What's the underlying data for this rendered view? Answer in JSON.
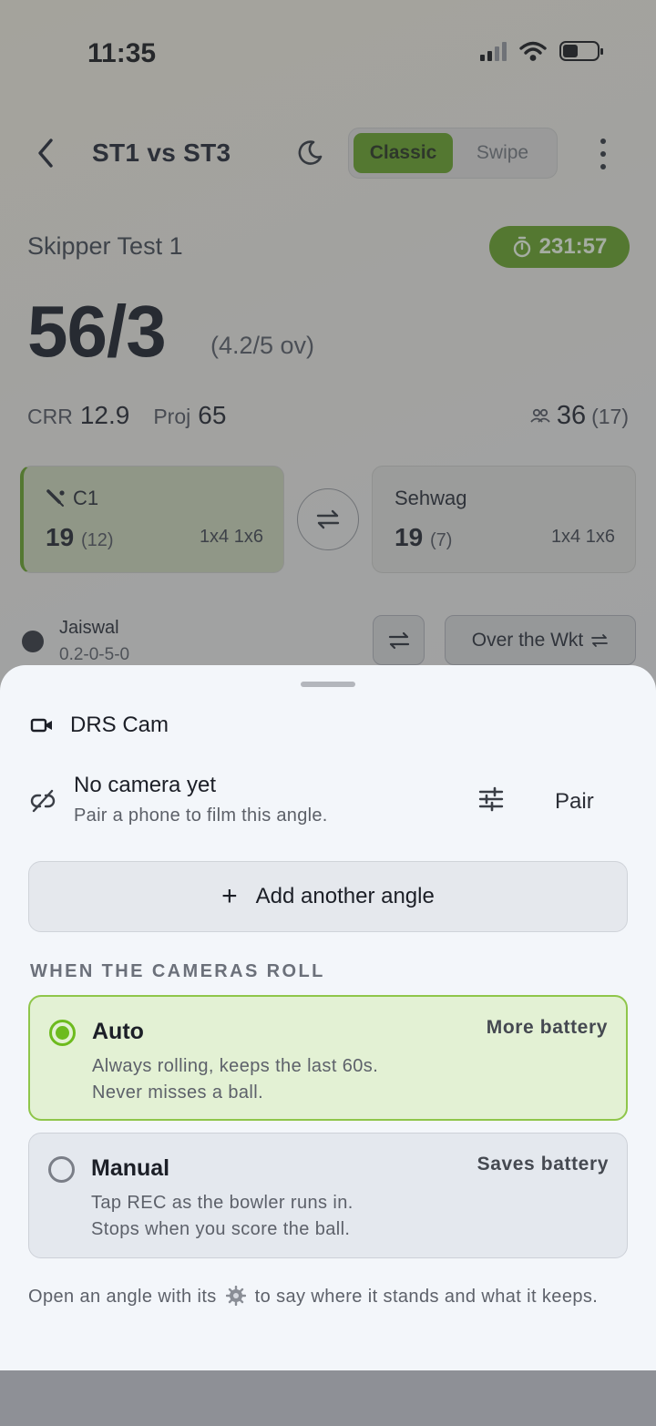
{
  "status_bar": {
    "time": "11:35"
  },
  "header": {
    "title": "ST1 vs ST3",
    "mode_options": [
      "Classic",
      "Swipe"
    ],
    "mode_selected": "Classic"
  },
  "innings": {
    "team": "Skipper Test 1",
    "timer": "231:57",
    "score": "56/3",
    "overs": "(4.2/5 ov)",
    "crr_label": "CRR",
    "crr": "12.9",
    "proj_label": "Proj",
    "proj": "65",
    "partnership_runs": "36",
    "partnership_balls": "(17)"
  },
  "batters": [
    {
      "name": "C1",
      "runs": "19",
      "balls": "(12)",
      "boundaries": "1x4 1x6",
      "on_strike": true
    },
    {
      "name": "Sehwag",
      "runs": "19",
      "balls": "(7)",
      "boundaries": "1x4 1x6",
      "on_strike": false
    }
  ],
  "bowler": {
    "name": "Jaiswal",
    "figures": "0.2-0-5-0",
    "side_label": "Over the Wkt"
  },
  "sheet": {
    "title": "DRS Cam",
    "camera": {
      "title": "No camera yet",
      "subtitle": "Pair a phone to film this angle.",
      "pair_label": "Pair"
    },
    "add_angle_label": "Add another angle",
    "section_label": "WHEN THE CAMERAS ROLL",
    "options": [
      {
        "title": "Auto",
        "tag": "More battery",
        "line1": "Always rolling, keeps the last 60s.",
        "line2": "Never misses a ball.",
        "selected": true
      },
      {
        "title": "Manual",
        "tag": "Saves battery",
        "line1": "Tap REC as the bowler runs in.",
        "line2": "Stops when you score the ball.",
        "selected": false
      }
    ],
    "footnote_before": "Open an angle with its",
    "footnote_after": "to say where it stands and what it keeps."
  },
  "colors": {
    "accent_green": "#5f9a1a",
    "radio_green": "#6dbb1e",
    "sheet_bg": "#f3f6fa"
  }
}
